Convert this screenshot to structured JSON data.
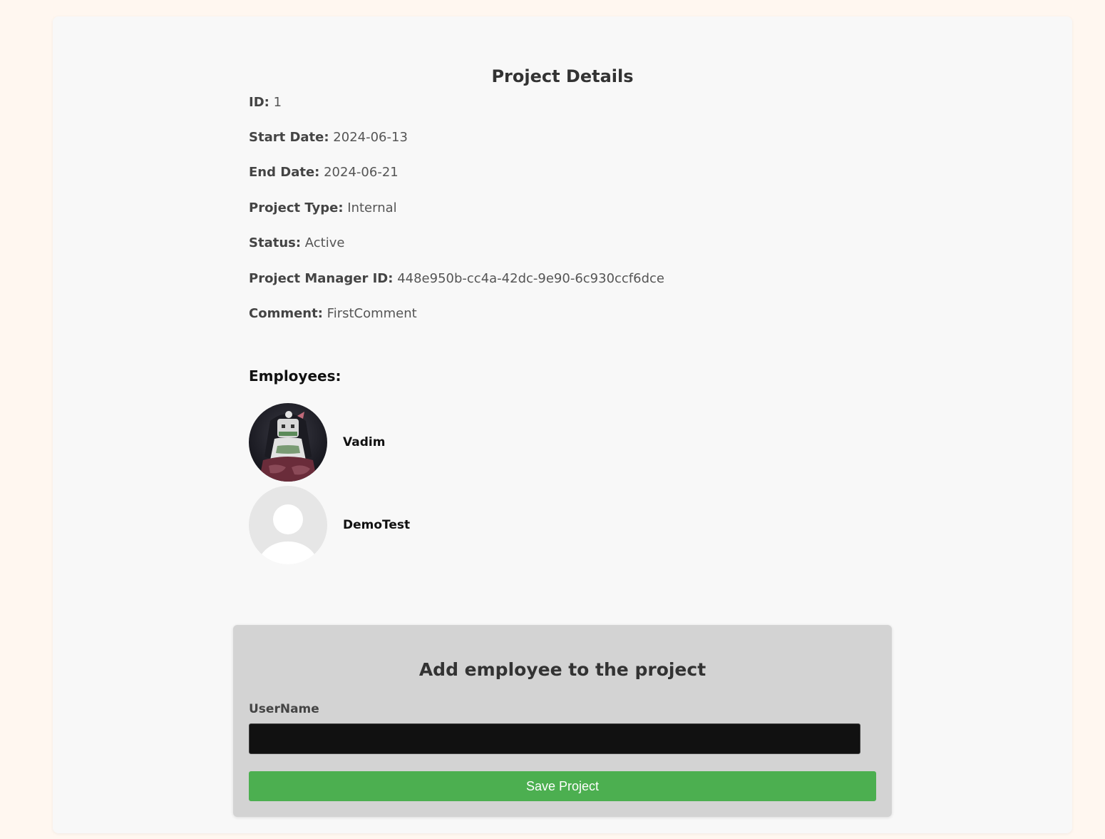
{
  "page": {
    "title": "Project Details"
  },
  "details": [
    {
      "label": "ID:",
      "value": "1"
    },
    {
      "label": "Start Date:",
      "value": "2024-06-13"
    },
    {
      "label": "End Date:",
      "value": "2024-06-21"
    },
    {
      "label": "Project Type:",
      "value": "Internal"
    },
    {
      "label": "Status:",
      "value": "Active"
    },
    {
      "label": "Project Manager ID:",
      "value": "448e950b-cc4a-42dc-9e90-6c930ccf6dce"
    },
    {
      "label": "Comment:",
      "value": "FirstComment"
    }
  ],
  "employees": {
    "heading": "Employees:",
    "items": [
      {
        "name": "Vadim",
        "avatar": "custom-photo"
      },
      {
        "name": "DemoTest",
        "avatar": "default-user-icon"
      }
    ]
  },
  "add_form": {
    "title": "Add employee to the project",
    "username_label": "UserName",
    "username_value": "",
    "username_placeholder": "",
    "save_label": "Save Project"
  },
  "colors": {
    "page_background": "#fff7f0",
    "card_background": "#f8f8f8",
    "panel_background": "#d3d3d3",
    "input_background": "#111111",
    "save_button": "#4caf50"
  }
}
